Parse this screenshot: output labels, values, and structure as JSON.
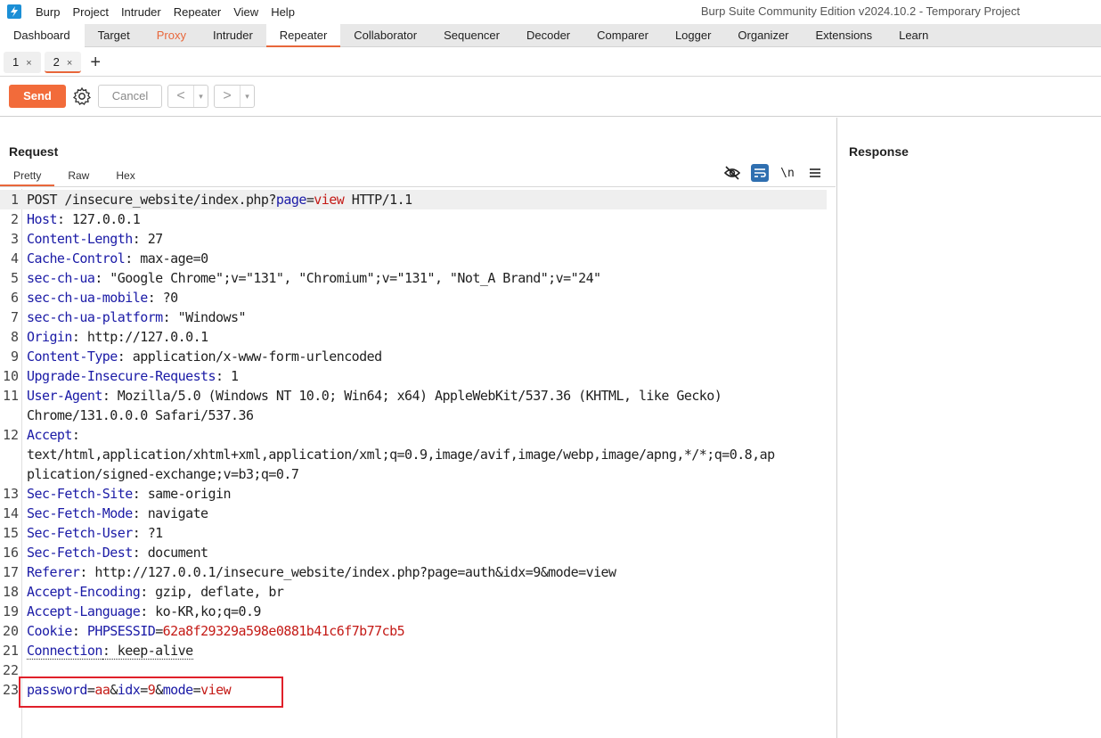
{
  "menubar": {
    "items": [
      "Burp",
      "Project",
      "Intruder",
      "Repeater",
      "View",
      "Help"
    ],
    "window_title": "Burp Suite Community Edition v2024.10.2 - Temporary Project"
  },
  "main_tabs": [
    "Dashboard",
    "Target",
    "Proxy",
    "Intruder",
    "Repeater",
    "Collaborator",
    "Sequencer",
    "Decoder",
    "Comparer",
    "Logger",
    "Organizer",
    "Extensions",
    "Learn"
  ],
  "active_main_tab": "Repeater",
  "sub_tabs": [
    {
      "label": "1",
      "close": "×"
    },
    {
      "label": "2",
      "close": "×"
    }
  ],
  "add_tab": "+",
  "toolbar": {
    "send_label": "Send",
    "cancel_label": "Cancel",
    "back_arrow": "<",
    "forward_arrow": ">",
    "dropdown": "▾"
  },
  "request": {
    "title": "Request",
    "view_tabs": [
      "Pretty",
      "Raw",
      "Hex"
    ],
    "newline_toggle": "\\n",
    "icons": [
      "eye-slash-icon",
      "wrap-icon",
      "newline-icon",
      "menu-icon"
    ]
  },
  "response": {
    "title": "Response"
  },
  "colors": {
    "accent": "#e8673b",
    "header_key": "#1a1aa6",
    "param_value": "#c41a16",
    "highlight": "#e0202a"
  },
  "request_lines": [
    {
      "n": "1",
      "method": "POST /insecure_website/index.php?",
      "param": "page",
      "eq": "=",
      "pval": "view",
      "rest": " HTTP/1.1"
    },
    {
      "n": "2",
      "key": "Host",
      "val": ": 127.0.0.1"
    },
    {
      "n": "3",
      "key": "Content-Length",
      "val": ": 27"
    },
    {
      "n": "4",
      "key": "Cache-Control",
      "val": ": max-age=0"
    },
    {
      "n": "5",
      "key": "sec-ch-ua",
      "val": ": \"Google Chrome\";v=\"131\", \"Chromium\";v=\"131\", \"Not_A Brand\";v=\"24\""
    },
    {
      "n": "6",
      "key": "sec-ch-ua-mobile",
      "val": ": ?0"
    },
    {
      "n": "7",
      "key": "sec-ch-ua-platform",
      "val": ": \"Windows\""
    },
    {
      "n": "8",
      "key": "Origin",
      "val": ": http://127.0.0.1"
    },
    {
      "n": "9",
      "key": "Content-Type",
      "val": ": application/x-www-form-urlencoded"
    },
    {
      "n": "10",
      "key": "Upgrade-Insecure-Requests",
      "val": ": 1"
    },
    {
      "n": "11",
      "key": "User-Agent",
      "val": ": Mozilla/5.0 (Windows NT 10.0; Win64; x64) AppleWebKit/537.36 (KHTML, like Gecko)",
      "cont": "Chrome/131.0.0.0 Safari/537.36"
    },
    {
      "n": "12",
      "key": "Accept",
      "val": ":",
      "cont": "text/html,application/xhtml+xml,application/xml;q=0.9,image/avif,image/webp,image/apng,*/*;q=0.8,ap",
      "cont2": "plication/signed-exchange;v=b3;q=0.7"
    },
    {
      "n": "13",
      "key": "Sec-Fetch-Site",
      "val": ": same-origin"
    },
    {
      "n": "14",
      "key": "Sec-Fetch-Mode",
      "val": ": navigate"
    },
    {
      "n": "15",
      "key": "Sec-Fetch-User",
      "val": ": ?1"
    },
    {
      "n": "16",
      "key": "Sec-Fetch-Dest",
      "val": ": document"
    },
    {
      "n": "17",
      "key": "Referer",
      "val": ": http://127.0.0.1/insecure_website/index.php?page=auth&idx=9&mode=view"
    },
    {
      "n": "18",
      "key": "Accept-Encoding",
      "val": ": gzip, deflate, br"
    },
    {
      "n": "19",
      "key": "Accept-Language",
      "val": ": ko-KR,ko;q=0.9"
    },
    {
      "n": "20",
      "key": "Cookie",
      "val": ": ",
      "ckey": "PHPSESSID",
      "ceq": "=",
      "cval": "62a8f29329a598e0881b41c6f7b77cb5"
    },
    {
      "n": "21",
      "key": "Connection",
      "val": ": keep-alive"
    },
    {
      "n": "22"
    },
    {
      "n": "23",
      "body": [
        {
          "k": "password",
          "v": "aa"
        },
        {
          "k": "idx",
          "v": "9"
        },
        {
          "k": "mode",
          "v": "view"
        }
      ],
      "amp": "&",
      "eq": "="
    }
  ]
}
